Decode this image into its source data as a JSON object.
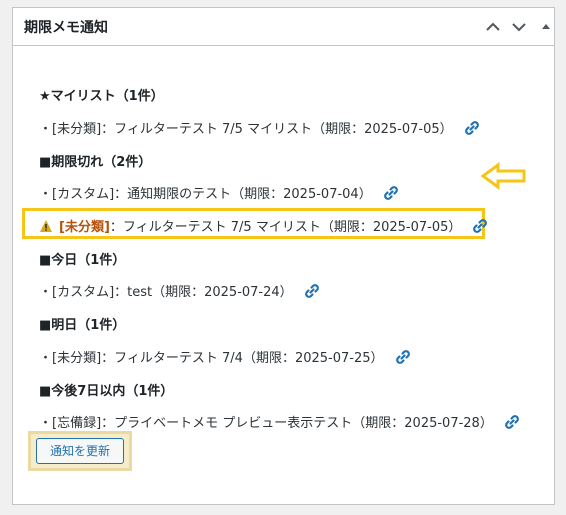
{
  "widget": {
    "title": "期限メモ通知"
  },
  "sections": {
    "my_list": {
      "heading": "★マイリスト（1件）",
      "items": [
        "・[未分類]：フィルターテスト 7/5 マイリスト（期限：2025-07-05）"
      ]
    },
    "expired": {
      "heading": "■期限切れ（2件）",
      "items": [
        "・[カスタム]：通知期限のテスト（期限：2025-07-04）"
      ],
      "highlighted": {
        "tag": "[未分類]",
        "text": "：フィルターテスト 7/5 マイリスト（期限：2025-07-05）"
      }
    },
    "today": {
      "heading": "■今日（1件）",
      "items": [
        "・[カスタム]：test（期限：2025-07-24）"
      ]
    },
    "tomorrow": {
      "heading": "■明日（1件）",
      "items": [
        "・[未分類]：フィルターテスト 7/4（期限：2025-07-25）"
      ]
    },
    "within_7_days": {
      "heading": "■今後7日以内（1件）",
      "items": [
        "・[忘備録]：プライベートメモ プレビュー表示テスト（期限：2025-07-28）"
      ]
    }
  },
  "refresh_button": {
    "label": "通知を更新"
  },
  "icons": {
    "collapse_up": "chevron-up-icon",
    "collapse_down": "chevron-down-icon",
    "toggle": "triangle-up-icon",
    "link": "link-icon",
    "warning": "warning-icon",
    "annotation_arrow": "arrow-left-icon"
  },
  "colors": {
    "link_blue": "#2271b1",
    "highlight_yellow": "#f5c518",
    "tag_orange": "#b45309",
    "warning_yellow": "#dba617"
  }
}
